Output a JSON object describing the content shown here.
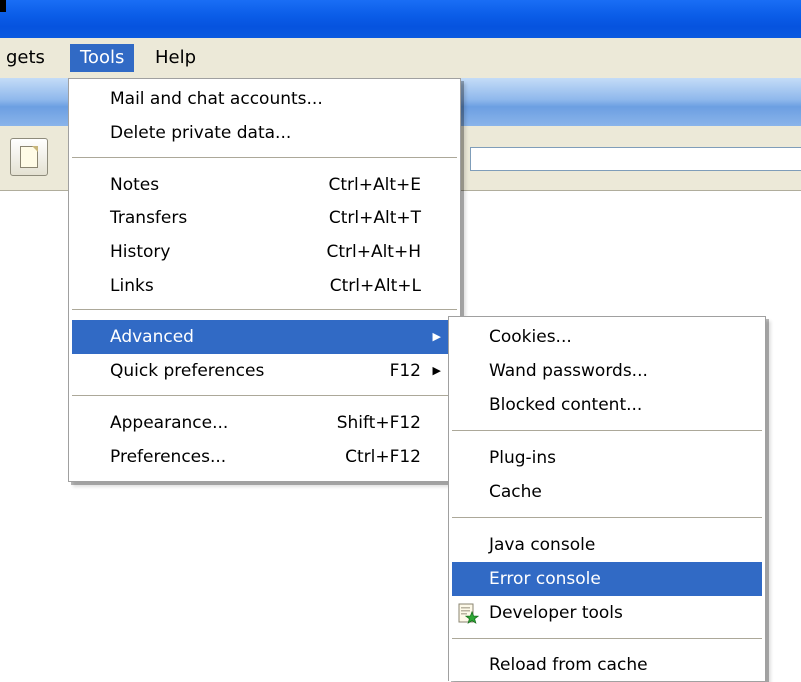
{
  "menubar": {
    "items": [
      {
        "label": "gets"
      },
      {
        "label": "Tools"
      },
      {
        "label": "Help"
      }
    ]
  },
  "tools_menu": {
    "items": [
      {
        "label": "Mail and chat accounts..."
      },
      {
        "label": "Delete private data..."
      },
      {
        "label": "Notes",
        "shortcut": "Ctrl+Alt+E"
      },
      {
        "label": "Transfers",
        "shortcut": "Ctrl+Alt+T"
      },
      {
        "label": "History",
        "shortcut": "Ctrl+Alt+H"
      },
      {
        "label": "Links",
        "shortcut": "Ctrl+Alt+L"
      },
      {
        "label": "Advanced",
        "submenu_arrow": "▶"
      },
      {
        "label": "Quick preferences",
        "shortcut": "F12",
        "submenu_arrow": "▶"
      },
      {
        "label": "Appearance...",
        "shortcut": "Shift+F12"
      },
      {
        "label": "Preferences...",
        "shortcut": "Ctrl+F12"
      }
    ]
  },
  "advanced_menu": {
    "items": [
      {
        "label": "Cookies..."
      },
      {
        "label": "Wand passwords..."
      },
      {
        "label": "Blocked content..."
      },
      {
        "label": "Plug-ins"
      },
      {
        "label": "Cache"
      },
      {
        "label": "Java console"
      },
      {
        "label": "Error console"
      },
      {
        "label": "Developer tools",
        "icon": "developer-tools-icon"
      },
      {
        "label": "Reload from cache"
      }
    ]
  },
  "colors": {
    "title_bar": "#0b5de8",
    "menu_highlight": "#316ac5",
    "menu_bar_bg": "#ece9d8"
  }
}
